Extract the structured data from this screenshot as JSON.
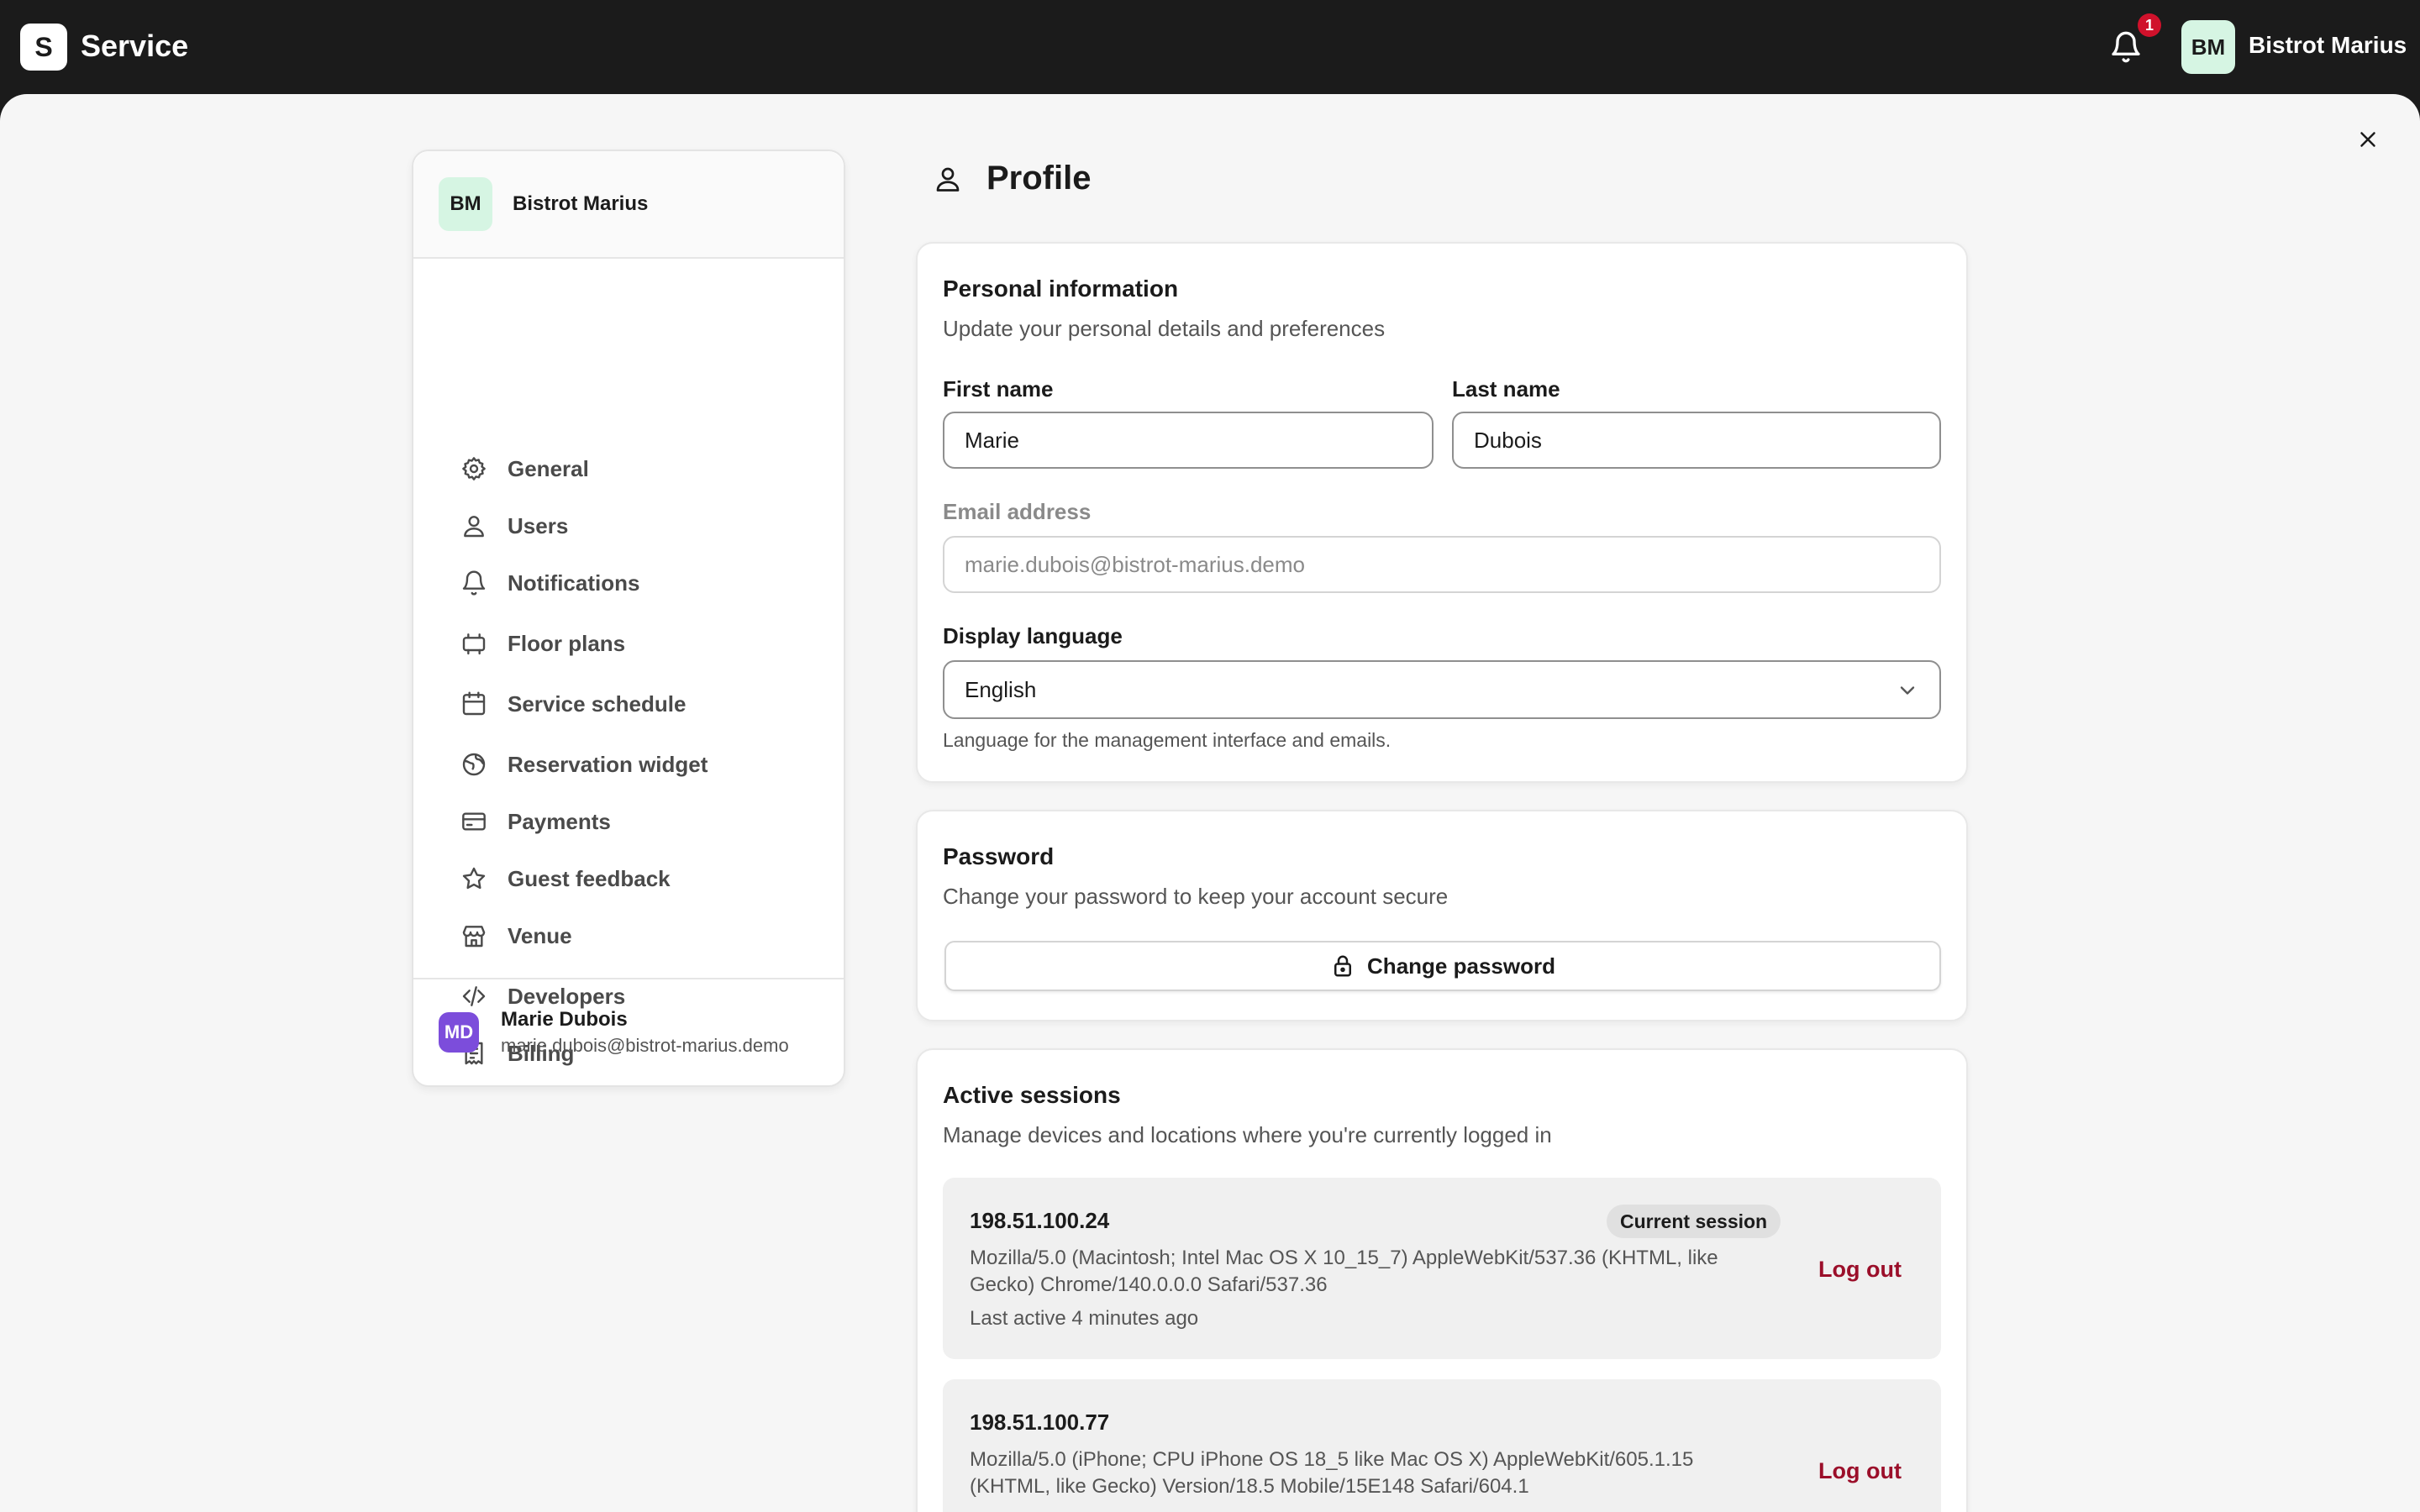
{
  "app": {
    "logo_letter": "S",
    "title": "Service"
  },
  "topbar": {
    "notification_count": "1",
    "avatar_initials": "BM",
    "venue_name": "Bistrot Marius"
  },
  "sidebar": {
    "header": {
      "initials": "BM",
      "venue_name": "Bistrot Marius"
    },
    "items": [
      {
        "label": "General",
        "icon": "gear-icon"
      },
      {
        "label": "Users",
        "icon": "user-icon"
      },
      {
        "label": "Notifications",
        "icon": "bell-icon"
      },
      {
        "label": "Floor plans",
        "icon": "floor-plan-icon"
      },
      {
        "label": "Service schedule",
        "icon": "calendar-icon"
      },
      {
        "label": "Reservation widget",
        "icon": "globe-icon"
      },
      {
        "label": "Payments",
        "icon": "credit-card-icon"
      },
      {
        "label": "Guest feedback",
        "icon": "star-icon"
      },
      {
        "label": "Venue",
        "icon": "store-icon"
      },
      {
        "label": "Developers",
        "icon": "code-icon"
      },
      {
        "label": "Billing",
        "icon": "receipt-icon"
      }
    ],
    "footer": {
      "initials": "MD",
      "name": "Marie Dubois",
      "email": "marie.dubois@bistrot-marius.demo"
    }
  },
  "page": {
    "title": "Profile",
    "icon": "user-icon"
  },
  "personal_info": {
    "title": "Personal information",
    "subtitle": "Update your personal details and preferences",
    "first_name_label": "First name",
    "first_name_value": "Marie",
    "last_name_label": "Last name",
    "last_name_value": "Dubois",
    "email_label": "Email address",
    "email_value": "marie.dubois@bistrot-marius.demo",
    "language_label": "Display language",
    "language_value": "English",
    "language_helper": "Language for the management interface and emails."
  },
  "password": {
    "title": "Password",
    "subtitle": "Change your password to keep your account secure",
    "button_label": "Change password"
  },
  "sessions": {
    "title": "Active sessions",
    "subtitle": "Manage devices and locations where you're currently logged in",
    "items": [
      {
        "ip": "198.51.100.24",
        "user_agent": "Mozilla/5.0 (Macintosh; Intel Mac OS X 10_15_7) AppleWebKit/537.36 (KHTML, like Gecko) Chrome/140.0.0.0 Safari/537.36",
        "last_active": "Last active 4 minutes ago",
        "badge": "Current session",
        "action": "Log out"
      },
      {
        "ip": "198.51.100.77",
        "user_agent": "Mozilla/5.0 (iPhone; CPU iPhone OS 18_5 like Mac OS X) AppleWebKit/605.1.15 (KHTML, like Gecko) Version/18.5 Mobile/15E148 Safari/604.1",
        "action": "Log out"
      }
    ]
  },
  "colors": {
    "topbar_bg": "#1b1b1b",
    "page_bg": "#f6f6f6",
    "badge_red": "#d0112b",
    "logout_red": "#9b0f2a",
    "venue_avatar": "#d6f5e3",
    "user_avatar": "#7c4ddb"
  }
}
